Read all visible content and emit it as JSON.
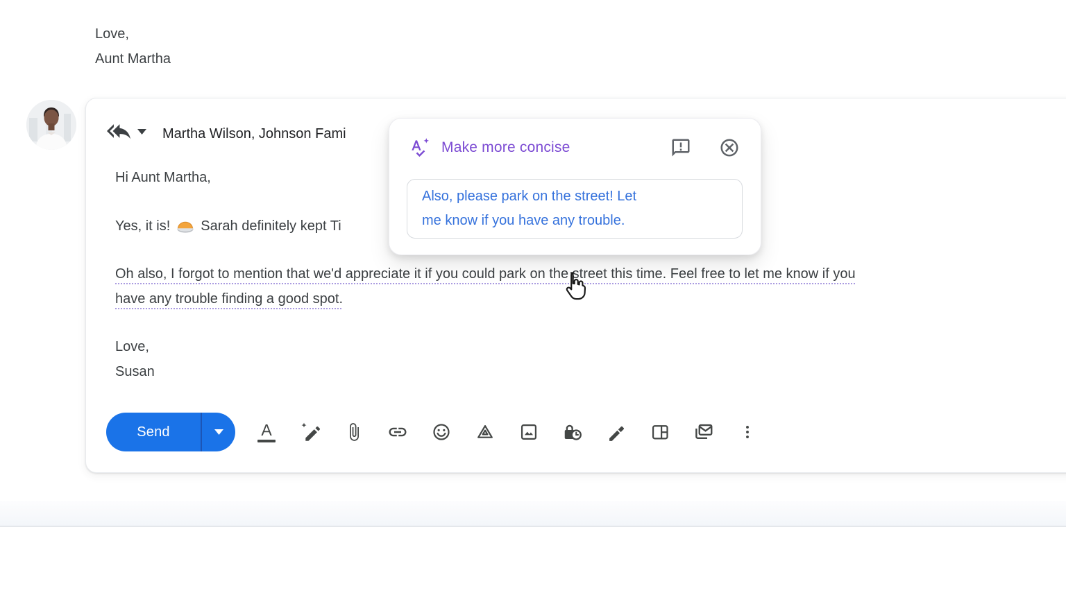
{
  "previous_email": {
    "signature_lines": [
      "Love,",
      "Aunt Martha"
    ]
  },
  "compose": {
    "reply_header": {
      "recipients": "Martha Wilson, Johnson Fami",
      "icons": [
        "reply-all-icon",
        "recipient-dropdown-caret-icon"
      ]
    },
    "body": {
      "greeting": "Hi Aunt Martha,",
      "pie_line": {
        "before": "Yes, it is!",
        "emoji_name": "pie-emoji",
        "after": "Sarah definitely kept Ti"
      },
      "highlighted_lines": [
        "Oh also, I forgot to mention that we'd appreciate it if you could park on the street this time. Feel free to let me know if you",
        "have any trouble finding a good spot."
      ],
      "signature_lines": [
        "Love,",
        "Susan"
      ]
    },
    "toolbar": {
      "send_label": "Send",
      "formatting_letter": "A",
      "icons": [
        "formatting-options-icon",
        "help-me-write-pen-spark-icon",
        "attach-file-icon",
        "insert-link-icon",
        "insert-emoji-icon",
        "google-drive-icon",
        "insert-photo-icon",
        "confidential-mode-icon",
        "insert-signature-pen-icon",
        "layouts-icon",
        "multi-send-icon",
        "more-options-icon"
      ]
    }
  },
  "ai_popup": {
    "title": "Make more concise",
    "icons": [
      "pen-spark-a-icon",
      "feedback-icon",
      "close-icon"
    ],
    "suggestion_lines": [
      "Also, please park on the street! Let",
      "me know if you have any trouble."
    ]
  },
  "colors": {
    "accent_purple": "#7c4bd3",
    "suggestion_blue": "#3471dc",
    "send_blue": "#1a73e8",
    "icon_gray": "#444746",
    "underline_purple": "#a99ae0"
  }
}
